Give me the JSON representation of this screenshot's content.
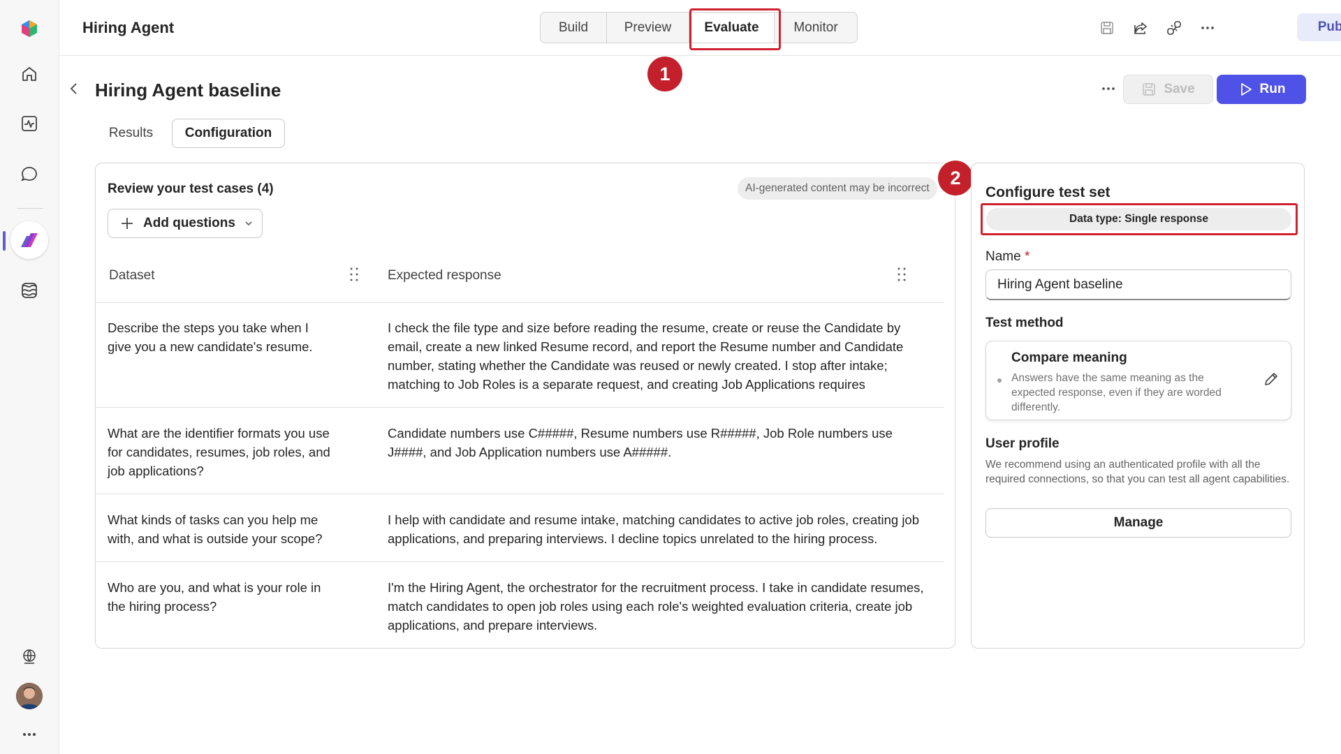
{
  "app": {
    "title": "Hiring Agent",
    "publish_label": "Publish"
  },
  "top_tabs": [
    {
      "label": "Build"
    },
    {
      "label": "Preview"
    },
    {
      "label": "Evaluate",
      "active": true
    },
    {
      "label": "Monitor"
    }
  ],
  "annotations": {
    "badge1": "1",
    "badge2": "2",
    "highlight_color": "#d0202e"
  },
  "page": {
    "title": "Hiring Agent baseline",
    "save_label": "Save",
    "run_label": "Run",
    "subtabs": {
      "results": "Results",
      "configuration": "Configuration"
    }
  },
  "test_cases": {
    "title": "Review your test cases (4)",
    "ai_note": "AI-generated content may be incorrect",
    "add_questions_label": "Add questions",
    "columns": {
      "dataset": "Dataset",
      "expected": "Expected response"
    },
    "rows": [
      {
        "question": "Describe the steps you take when I give you a new candidate's resume.",
        "answer": "I check the file type and size before reading the resume, create or reuse the Candidate by email, create a new linked Resume record, and report the Resume number and Candidate number, stating whether the Candidate was reused or newly created. I stop after intake; matching to Job Roles is a separate request, and creating Job Applications requires"
      },
      {
        "question": "What are the identifier formats you use for candidates, resumes, job roles, and job applications?",
        "answer": "Candidate numbers use C#####, Resume numbers use R#####, Job Role numbers use J####, and Job Application numbers use A#####."
      },
      {
        "question": "What kinds of tasks can you help me with, and what is outside your scope?",
        "answer": "I help with candidate and resume intake, matching candidates to active job roles, creating job applications, and preparing interviews. I decline topics unrelated to the hiring process."
      },
      {
        "question": "Who are you, and what is your role in the hiring process?",
        "answer": "I'm the Hiring Agent, the orchestrator for the recruitment process. I take in candidate resumes, match candidates to open job roles using each role's weighted evaluation criteria, create job applications, and prepare interviews."
      }
    ]
  },
  "config": {
    "title": "Configure test set",
    "data_type": "Data type: Single response",
    "name_label": "Name",
    "name_required": "*",
    "name_value": "Hiring Agent baseline",
    "test_method_label": "Test method",
    "method_title": "Compare meaning",
    "method_desc": "Answers have the same meaning as the expected response, even if they are worded differently.",
    "user_profile_label": "User profile",
    "user_profile_desc": "We recommend using an authenticated profile with all the required connections, so that you can test all agent capabilities.",
    "manage_label": "Manage"
  },
  "icons": {
    "rail": [
      "app-logo-icon",
      "home-icon",
      "activity-icon",
      "chat-icon",
      "agent-icon",
      "library-icon",
      "globe-icon",
      "more-icon"
    ],
    "top": [
      "save-icon",
      "share-icon",
      "connections-icon",
      "more-icon"
    ]
  }
}
